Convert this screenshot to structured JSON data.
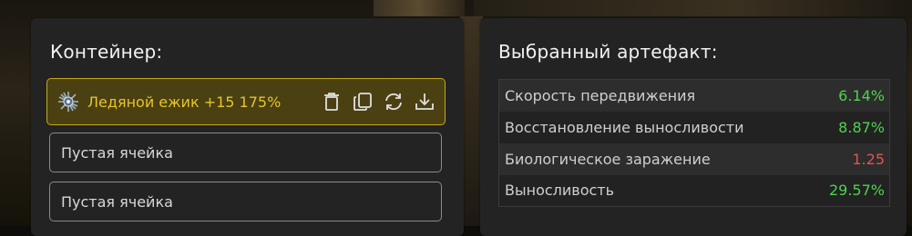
{
  "container": {
    "title": "Контейнер:",
    "selected_slot": {
      "icon": "ice-hedgehog-artifact-icon",
      "label": "Ледяной ежик +15 175%",
      "actions": [
        {
          "icon": "trash-icon"
        },
        {
          "icon": "copy-icon"
        },
        {
          "icon": "refresh-icon"
        },
        {
          "icon": "download-icon"
        }
      ]
    },
    "empty_slots": [
      "Пустая ячейка",
      "Пустая ячейка"
    ]
  },
  "artifact": {
    "title": "Выбранный артефакт:",
    "stats": [
      {
        "name": "Скорость передвижения",
        "value": "6.14%",
        "sign": "positive"
      },
      {
        "name": "Восстановление выносливости",
        "value": "8.87%",
        "sign": "positive"
      },
      {
        "name": "Биологическое заражение",
        "value": "1.25",
        "sign": "negative"
      },
      {
        "name": "Выносливость",
        "value": "29.57%",
        "sign": "positive"
      }
    ]
  },
  "colors": {
    "selected_bg": "#4a4012",
    "selected_border": "#c8a81e",
    "selected_text": "#e6c52a",
    "positive": "#4fd24f",
    "negative": "#e05454"
  }
}
